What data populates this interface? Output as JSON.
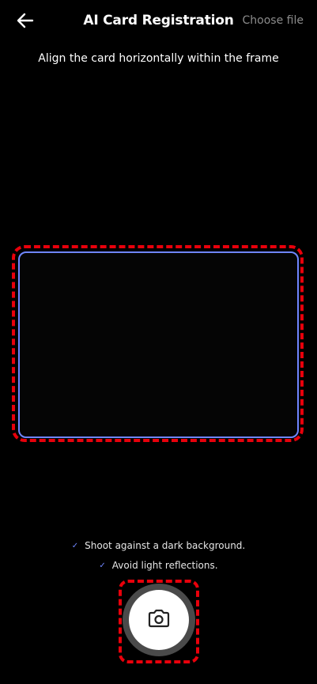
{
  "header": {
    "title": "AI Card Registration",
    "choose_file_label": "Choose file",
    "back_icon": "arrow-left-icon"
  },
  "instruction": "Align the card horizontally within the frame",
  "tips": [
    {
      "icon": "check-icon",
      "text": "Shoot against a dark background."
    },
    {
      "icon": "check-icon",
      "text": "Avoid light reflections."
    }
  ],
  "shutter": {
    "icon": "camera-icon"
  },
  "colors": {
    "background": "#000000",
    "frame_border": "#6f86ff",
    "check": "#6f86ff",
    "highlight_outline": "#e8000b",
    "secondary_text": "#8c8c8c"
  }
}
